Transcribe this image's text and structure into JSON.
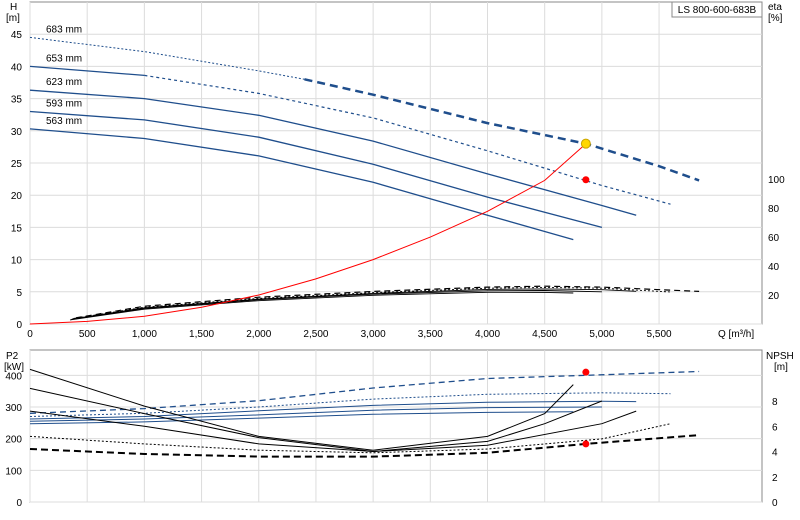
{
  "chart_data": [
    {
      "type": "line",
      "title": "LS 800-600-683B",
      "xlabel": "Q [m³/h]",
      "ylabel_left_unit": "H",
      "ylabel_left_unit2": "[m]",
      "ylabel_right_unit": "eta",
      "ylabel_right_unit2": "[%]",
      "xlim": [
        0,
        6400
      ],
      "ylim_left": [
        0,
        50
      ],
      "ylim_right_ticks": [
        0,
        20,
        40,
        60,
        80,
        100
      ],
      "x_ticks": [
        "0",
        "500",
        "1,000",
        "1,500",
        "2,000",
        "2,500",
        "3,000",
        "3,500",
        "4,000",
        "4,500",
        "5,000",
        "5,500"
      ],
      "x_tick_values": [
        0,
        500,
        1000,
        1500,
        2000,
        2500,
        3000,
        3500,
        4000,
        4500,
        5000,
        5500
      ],
      "y_ticks_left": [
        "0",
        "5",
        "10",
        "15",
        "20",
        "25",
        "30",
        "35",
        "40",
        "45"
      ],
      "y_tick_values_left": [
        0,
        5,
        10,
        15,
        20,
        25,
        30,
        35,
        40,
        45
      ],
      "y_ticks_right": [
        "20",
        "40",
        "60",
        "80",
        "100"
      ],
      "y_tick_values_right": [
        20,
        40,
        60,
        80,
        100
      ],
      "grid": true,
      "head_curves": [
        {
          "name": "683 mm",
          "solid_to": 0,
          "dotted_to": 2400,
          "dashed_to": 5850,
          "points": [
            [
              0,
              44.5
            ],
            [
              1000,
              42.3
            ],
            [
              2000,
              39.3
            ],
            [
              2400,
              38.0
            ],
            [
              3000,
              35.6
            ],
            [
              4000,
              31.2
            ],
            [
              4860,
              28.0
            ],
            [
              5500,
              24.5
            ],
            [
              5850,
              22.3
            ]
          ]
        },
        {
          "name": "653 mm",
          "solid_to": 1000,
          "dotted_to": 5600,
          "points": [
            [
              0,
              40.0
            ],
            [
              1000,
              38.6
            ],
            [
              2000,
              35.8
            ],
            [
              3000,
              32.0
            ],
            [
              4000,
              26.9
            ],
            [
              5000,
              21.5
            ],
            [
              5600,
              18.6
            ]
          ]
        },
        {
          "name": "623 mm",
          "solid_to": 5300,
          "points": [
            [
              0,
              36.3
            ],
            [
              1000,
              35.0
            ],
            [
              2000,
              32.4
            ],
            [
              3000,
              28.4
            ],
            [
              4000,
              23.3
            ],
            [
              5000,
              18.4
            ],
            [
              5300,
              16.9
            ]
          ]
        },
        {
          "name": "593 mm",
          "solid_to": 5000,
          "points": [
            [
              0,
              33.0
            ],
            [
              1000,
              31.7
            ],
            [
              2000,
              29.0
            ],
            [
              3000,
              24.8
            ],
            [
              4000,
              19.7
            ],
            [
              5000,
              15.0
            ]
          ]
        },
        {
          "name": "563 mm",
          "solid_to": 4750,
          "points": [
            [
              0,
              30.3
            ],
            [
              1000,
              28.8
            ],
            [
              2000,
              26.1
            ],
            [
              3000,
              22.0
            ],
            [
              4000,
              16.9
            ],
            [
              4750,
              13.1
            ]
          ]
        }
      ],
      "efficiency_curves": [
        {
          "points": [
            [
              400,
              4.2
            ],
            [
              1000,
              12.3
            ],
            [
              2000,
              18.5
            ],
            [
              3000,
              22.5
            ],
            [
              4000,
              25.5
            ],
            [
              4500,
              26.1
            ],
            [
              5000,
              25.5
            ],
            [
              5850,
              22.5
            ]
          ],
          "style": "dashed"
        },
        {
          "points": [
            [
              380,
              3.8
            ],
            [
              1000,
              11.6
            ],
            [
              2000,
              17.7
            ],
            [
              3000,
              21.7
            ],
            [
              4000,
              24.7
            ],
            [
              4500,
              25.2
            ],
            [
              5000,
              24.7
            ],
            [
              5600,
              22.1
            ]
          ],
          "style": "dotted"
        },
        {
          "points": [
            [
              370,
              3.5
            ],
            [
              1000,
              11.2
            ],
            [
              2000,
              17.2
            ],
            [
              3000,
              21.1
            ],
            [
              4000,
              23.9
            ],
            [
              4500,
              24.2
            ],
            [
              5000,
              23.7
            ],
            [
              5300,
              22.6
            ]
          ],
          "style": "solid"
        },
        {
          "points": [
            [
              360,
              3.2
            ],
            [
              1000,
              10.8
            ],
            [
              2000,
              16.8
            ],
            [
              3000,
              20.6
            ],
            [
              4000,
              22.9
            ],
            [
              4500,
              23.1
            ],
            [
              5000,
              22.2
            ]
          ],
          "style": "solid"
        },
        {
          "points": [
            [
              350,
              2.8
            ],
            [
              1000,
              10.2
            ],
            [
              2000,
              16.1
            ],
            [
              3000,
              19.8
            ],
            [
              4000,
              21.9
            ],
            [
              4500,
              21.8
            ],
            [
              4750,
              21.4
            ]
          ],
          "style": "solid"
        }
      ],
      "system_curve": {
        "color": "#ff0000",
        "points": [
          [
            0,
            0
          ],
          [
            500,
            0.4
          ],
          [
            1000,
            1.2
          ],
          [
            1500,
            2.6
          ],
          [
            2000,
            4.5
          ],
          [
            2500,
            7.0
          ],
          [
            3000,
            10.0
          ],
          [
            3500,
            13.5
          ],
          [
            4000,
            17.5
          ],
          [
            4500,
            22.3
          ],
          [
            4860,
            28.0
          ]
        ]
      },
      "duty_point": {
        "x": 4860,
        "y": 28.0,
        "color": "#ffd700"
      },
      "eta_point": {
        "x": 4860,
        "y": 22.4,
        "color": "#ff0000"
      }
    },
    {
      "type": "line",
      "ylabel_left_unit": "P2",
      "ylabel_left_unit2": "[kW]",
      "ylabel_right_unit": "NPSH",
      "ylabel_right_unit2": "[m]",
      "xlim": [
        0,
        6400
      ],
      "ylim_left": [
        0,
        480
      ],
      "y_ticks_left": [
        "0",
        "100",
        "200",
        "300",
        "400"
      ],
      "y_tick_values_left": [
        0,
        100,
        200,
        300,
        400
      ],
      "y_ticks_right": [
        "0",
        "2",
        "4",
        "6",
        "8"
      ],
      "y_tick_values_right": [
        0,
        2,
        4,
        6,
        8
      ],
      "grid": true,
      "power_curves": [
        {
          "style": "dashed",
          "points": [
            [
              0,
              280
            ],
            [
              1000,
              295
            ],
            [
              2000,
              320
            ],
            [
              3000,
              360
            ],
            [
              4000,
              390
            ],
            [
              4860,
              400
            ],
            [
              5850,
              412
            ]
          ],
          "split": 2400,
          "color": "#1f4e8c"
        },
        {
          "style": "dotted",
          "points": [
            [
              0,
              270
            ],
            [
              1000,
              280
            ],
            [
              2000,
              300
            ],
            [
              3000,
              325
            ],
            [
              4000,
              340
            ],
            [
              5000,
              345
            ],
            [
              5600,
              342
            ]
          ],
          "color": "#1f4e8c"
        },
        {
          "style": "solid",
          "points": [
            [
              0,
              262
            ],
            [
              1000,
              270
            ],
            [
              2000,
              288
            ],
            [
              3000,
              305
            ],
            [
              4000,
              315
            ],
            [
              5000,
              318
            ],
            [
              5300,
              317
            ]
          ],
          "color": "#1f4e8c"
        },
        {
          "style": "solid",
          "points": [
            [
              0,
              255
            ],
            [
              1000,
              262
            ],
            [
              2000,
              275
            ],
            [
              3000,
              290
            ],
            [
              4000,
              298
            ],
            [
              5000,
              300
            ]
          ],
          "color": "#1f4e8c"
        },
        {
          "style": "solid",
          "points": [
            [
              0,
              247
            ],
            [
              1000,
              253
            ],
            [
              2000,
              265
            ],
            [
              3000,
              277
            ],
            [
              4000,
              283
            ],
            [
              4750,
              285
            ]
          ],
          "color": "#1f4e8c"
        }
      ],
      "npsh_curves": [
        {
          "style": "dashed",
          "points": [
            [
              0,
              4.2
            ],
            [
              1000,
              3.8
            ],
            [
              2000,
              3.6
            ],
            [
              3000,
              3.6
            ],
            [
              4000,
              3.9
            ],
            [
              4860,
              4.6
            ],
            [
              5850,
              5.3
            ]
          ],
          "split": 2400
        },
        {
          "style": "dotted",
          "points": [
            [
              0,
              5.2
            ],
            [
              1000,
              4.6
            ],
            [
              2000,
              4.1
            ],
            [
              3000,
              3.9
            ],
            [
              4000,
              4.2
            ],
            [
              5000,
              5.0
            ],
            [
              5600,
              6.2
            ]
          ]
        },
        {
          "style": "solid",
          "points": [
            [
              0,
              7.2
            ],
            [
              1000,
              6.0
            ],
            [
              2000,
              4.6
            ],
            [
              3000,
              4.0
            ],
            [
              4000,
              4.5
            ],
            [
              5000,
              6.2
            ],
            [
              5300,
              7.2
            ]
          ]
        },
        {
          "style": "solid",
          "points": [
            [
              0,
              9.0
            ],
            [
              1000,
              7.0
            ],
            [
              2000,
              5.1
            ],
            [
              3000,
              4.0
            ],
            [
              4000,
              4.8
            ],
            [
              4500,
              6.2
            ],
            [
              5000,
              8.0
            ]
          ]
        },
        {
          "style": "solid",
          "points": [
            [
              0,
              10.5
            ],
            [
              1000,
              7.6
            ],
            [
              2000,
              5.2
            ],
            [
              3000,
              4.1
            ],
            [
              4000,
              5.2
            ],
            [
              4500,
              7.0
            ],
            [
              4750,
              9.3
            ]
          ]
        }
      ],
      "power_point": {
        "x": 4860,
        "y": 410,
        "color": "#ff0000"
      },
      "npsh_point": {
        "x": 4860,
        "y": 4.6,
        "color": "#ff0000"
      }
    }
  ]
}
